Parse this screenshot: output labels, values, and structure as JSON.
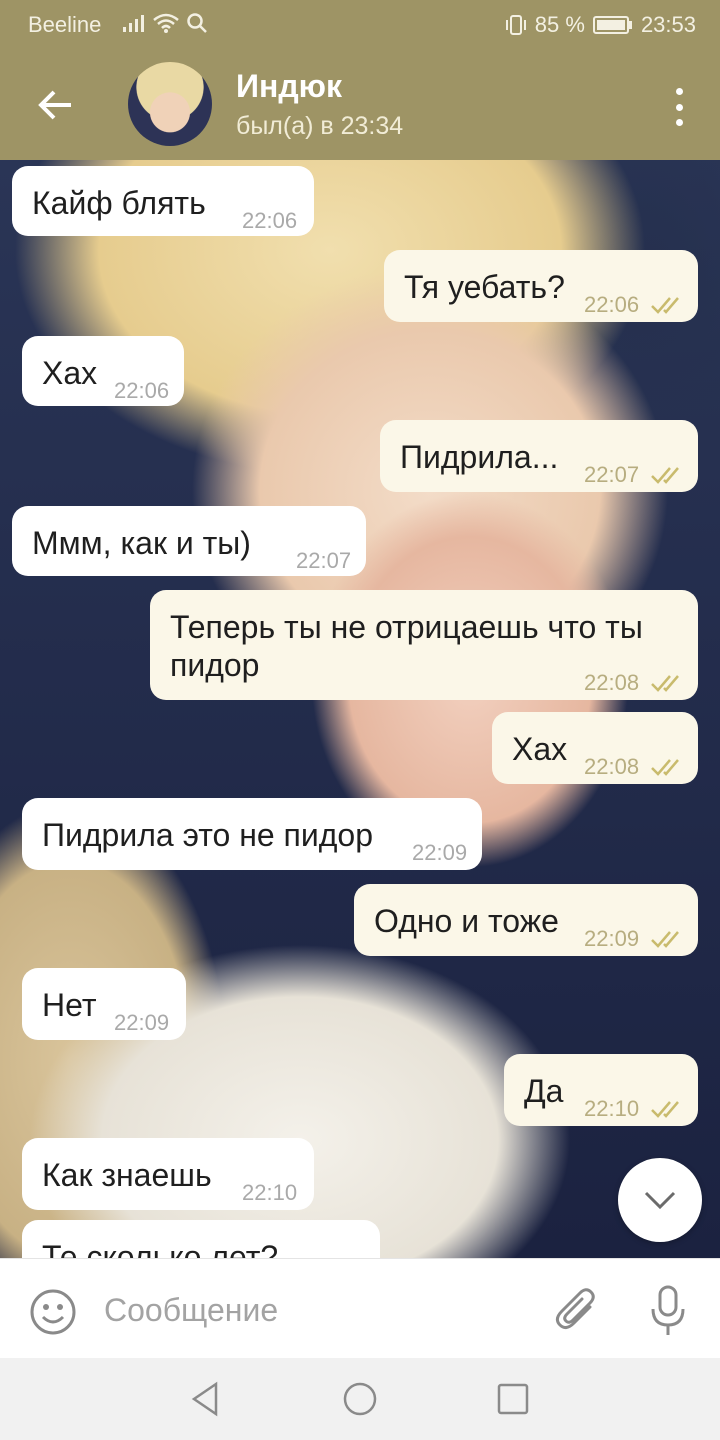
{
  "status_bar": {
    "carrier": "Beeline",
    "battery_percent": "85 %",
    "time": "23:53"
  },
  "header": {
    "contact_name": "Индюк",
    "last_seen": "был(а) в 23:34"
  },
  "messages": [
    {
      "direction": "in",
      "text": "Кайф блять",
      "time": "22:06"
    },
    {
      "direction": "out",
      "text": "Тя уебать?",
      "time": "22:06",
      "read": true
    },
    {
      "direction": "in",
      "text": "Хах",
      "time": "22:06"
    },
    {
      "direction": "out",
      "text": "Пидрила...",
      "time": "22:07",
      "read": true
    },
    {
      "direction": "in",
      "text": "Ммм, как и ты)",
      "time": "22:07"
    },
    {
      "direction": "out",
      "text": "Теперь ты не отрицаешь что ты",
      "text_line2": "пидор",
      "time": "22:08",
      "read": true
    },
    {
      "direction": "out",
      "text": "Хах",
      "time": "22:08",
      "read": true
    },
    {
      "direction": "in",
      "text": "Пидрила это не пидор",
      "time": "22:09"
    },
    {
      "direction": "out",
      "text": "Одно и тоже",
      "time": "22:09",
      "read": true
    },
    {
      "direction": "in",
      "text": "Нет",
      "time": "22:09"
    },
    {
      "direction": "out",
      "text": "Да",
      "time": "22:10",
      "read": true
    },
    {
      "direction": "in",
      "text": "Как знаешь",
      "time": "22:10"
    },
    {
      "direction": "in",
      "text": "Те сколько лет?",
      "time": ""
    }
  ],
  "input": {
    "placeholder": "Сообщение"
  },
  "colors": {
    "header": "#9e9465",
    "outgoing_bubble": "#fbf7e8",
    "incoming_bubble": "#ffffff",
    "read_checks": "#c9bb6d"
  },
  "icons": {
    "back": "arrow-left-icon",
    "menu": "more-vertical-icon",
    "scroll_down": "chevron-down-icon",
    "emoji": "smile-icon",
    "attach": "paperclip-icon",
    "mic": "microphone-icon",
    "nav_back": "triangle-back-icon",
    "nav_home": "circle-home-icon",
    "nav_recents": "square-recents-icon"
  }
}
